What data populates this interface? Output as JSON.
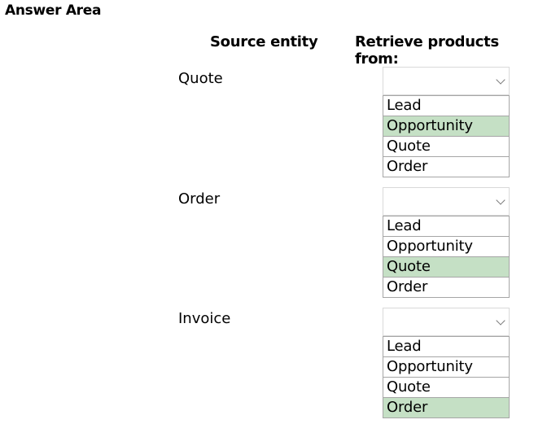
{
  "title": "Answer Area",
  "headers": {
    "source": "Source entity",
    "retrieve": "Retrieve products from:"
  },
  "rows": [
    {
      "source": "Quote",
      "options": [
        "Lead",
        "Opportunity",
        "Quote",
        "Order"
      ],
      "selected": "Opportunity"
    },
    {
      "source": "Order",
      "options": [
        "Lead",
        "Opportunity",
        "Quote",
        "Order"
      ],
      "selected": "Quote"
    },
    {
      "source": "Invoice",
      "options": [
        "Lead",
        "Opportunity",
        "Quote",
        "Order"
      ],
      "selected": "Order"
    }
  ],
  "colors": {
    "selected_bg": "#c5e0c5"
  }
}
